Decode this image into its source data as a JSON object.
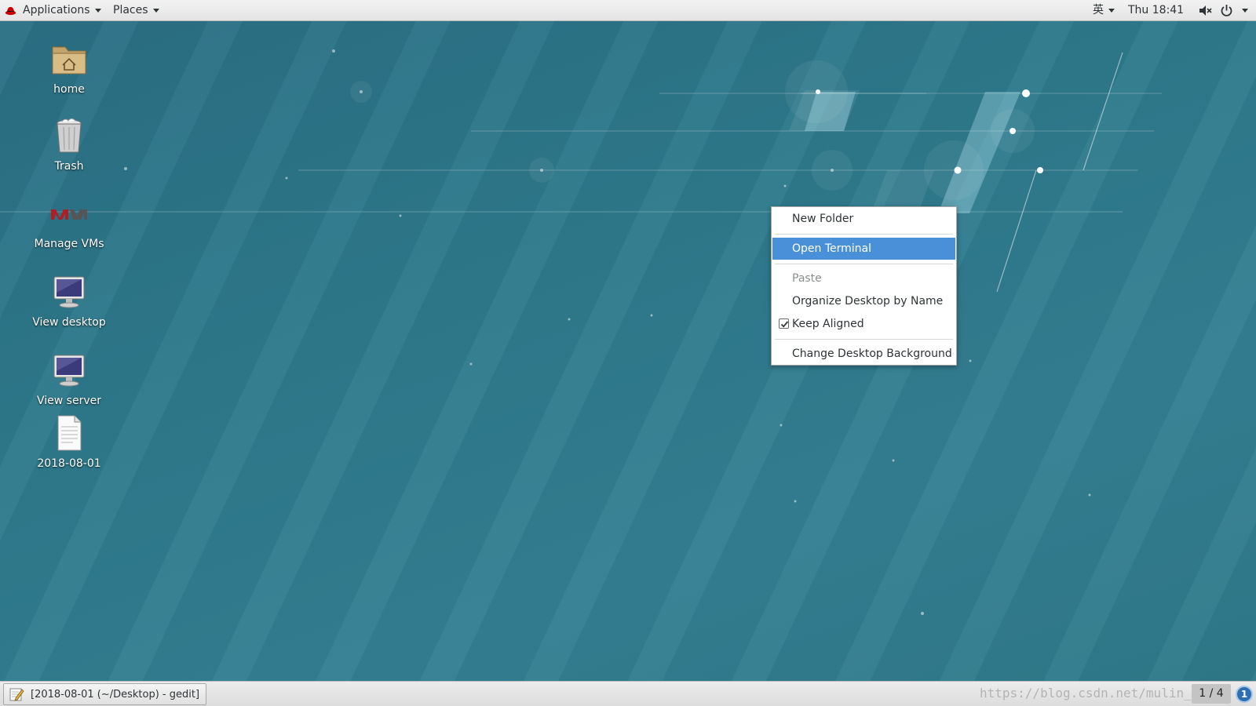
{
  "topbar": {
    "applications_label": "Applications",
    "places_label": "Places",
    "input_method": "英",
    "clock": "Thu 18:41"
  },
  "desktop": {
    "icons": [
      {
        "label": "home",
        "icon": "home-folder-icon"
      },
      {
        "label": "Trash",
        "icon": "trash-icon"
      },
      {
        "label": "Manage VMs",
        "icon": "vmm-icon"
      },
      {
        "label": "View desktop",
        "icon": "monitor-icon"
      },
      {
        "label": "View server",
        "icon": "monitor-icon"
      },
      {
        "label": "2018-08-01",
        "icon": "text-document-icon"
      }
    ]
  },
  "context_menu": {
    "items": [
      {
        "label": "New Folder",
        "mnemonic": "F"
      },
      {
        "label": "Open Terminal",
        "mnemonic": "e",
        "state": "highlighted"
      },
      {
        "label": "Paste",
        "state": "disabled"
      },
      {
        "label": "Organize Desktop by Name",
        "mnemonic": "O"
      },
      {
        "label": "Keep Aligned",
        "mnemonic": "K",
        "checked": true
      },
      {
        "label": "Change Desktop Background",
        "mnemonic": "B"
      }
    ]
  },
  "bottombar": {
    "task_label": "[2018-08-01 (~/Desktop) - gedit]",
    "watermark": "https://blog.csdn.net/mulin_",
    "workspace": "1 / 4",
    "notifications": "1"
  },
  "colors": {
    "highlight": "#4a90d9",
    "wallpaper": "#2f7d8c",
    "badge": "#2d6fb0"
  }
}
